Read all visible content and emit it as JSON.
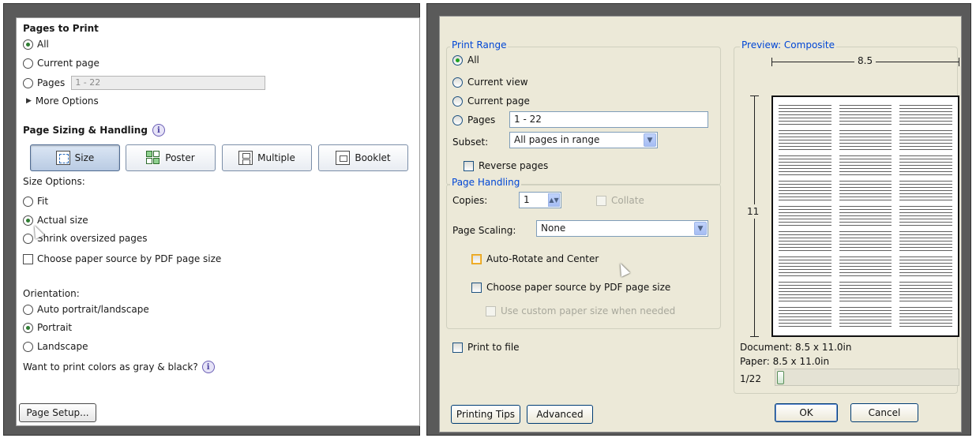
{
  "left": {
    "pages_to_print": {
      "title": "Pages to Print",
      "options": [
        "All",
        "Current page",
        "Pages"
      ],
      "selected": "All",
      "pages_value": "1 - 22",
      "more_options": "More Options"
    },
    "sizing": {
      "title": "Page Sizing & Handling",
      "modes": [
        "Size",
        "Poster",
        "Multiple",
        "Booklet"
      ],
      "selected_mode": "Size",
      "size_options_label": "Size Options:",
      "size_options": [
        "Fit",
        "Actual size",
        "Shrink oversized pages"
      ],
      "selected_size": "Actual size",
      "paper_source": "Choose paper source by PDF page size",
      "orientation_label": "Orientation:",
      "orientations": [
        "Auto portrait/landscape",
        "Portrait",
        "Landscape"
      ],
      "selected_orientation": "Portrait",
      "gray_question": "Want to print colors as gray & black?"
    },
    "page_setup_button": "Page Setup..."
  },
  "right": {
    "print_range": {
      "title": "Print Range",
      "options": [
        "All",
        "Current view",
        "Current page",
        "Pages"
      ],
      "selected": "All",
      "pages_value": "1 - 22",
      "subset_label": "Subset:",
      "subset_value": "All pages in range",
      "reverse_pages": "Reverse pages"
    },
    "page_handling": {
      "title": "Page Handling",
      "copies_label": "Copies:",
      "copies_value": "1",
      "collate": "Collate",
      "scaling_label": "Page Scaling:",
      "scaling_value": "None",
      "auto_rotate": "Auto-Rotate and Center",
      "paper_source": "Choose paper source by PDF page size",
      "custom_paper": "Use custom paper size when needed"
    },
    "print_to_file": "Print to file",
    "preview": {
      "title": "Preview: Composite",
      "width_label": "8.5",
      "height_label": "11",
      "document": "Document: 8.5 x 11.0in",
      "paper": "Paper: 8.5 x 11.0in",
      "page_counter": "1/22",
      "current_page": 1,
      "total_pages": 22
    },
    "buttons": {
      "printing_tips": "Printing Tips",
      "advanced": "Advanced",
      "ok": "OK",
      "cancel": "Cancel"
    }
  },
  "colors": {
    "xp_group_title": "#0046d5",
    "dialog_bg": "#ece9d8",
    "radio_selected": "#21a121"
  }
}
